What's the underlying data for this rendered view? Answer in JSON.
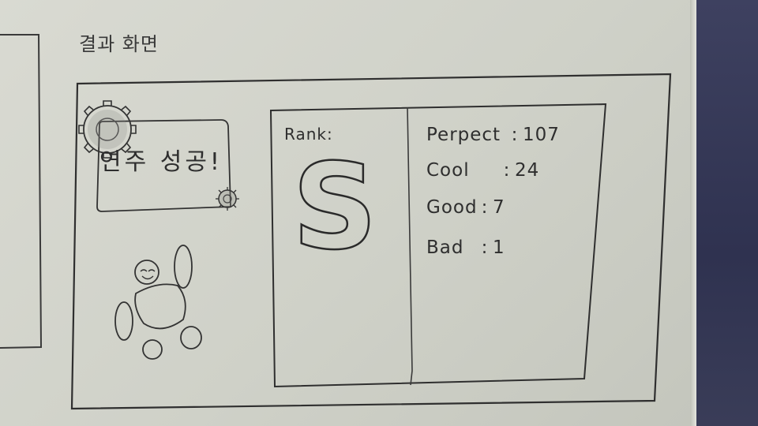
{
  "heading": "결과 화면",
  "banner": {
    "text": "연주 성공!"
  },
  "rank": {
    "label": "Rank:",
    "value": "S"
  },
  "stats": [
    {
      "label": "Perpect",
      "sep": ":",
      "value": "107"
    },
    {
      "label": "Cool",
      "sep": ":",
      "value": "24"
    },
    {
      "label": "Good",
      "sep": ":",
      "value": "7"
    },
    {
      "label": "Bad",
      "sep": ":",
      "value": "1"
    }
  ],
  "icons": [
    "gear-icon",
    "small-gear-icon",
    "character-icon"
  ],
  "colors": {
    "paper": "#d4d5cd",
    "ink": "#2e2e2e",
    "backdrop": "#33365a"
  }
}
